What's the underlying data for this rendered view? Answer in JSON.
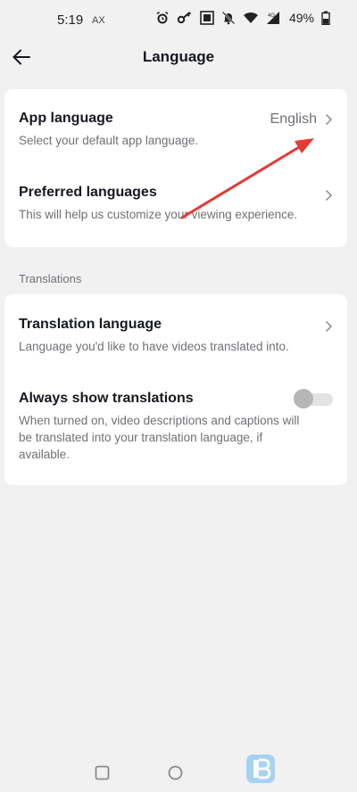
{
  "status_bar": {
    "time": "5:19",
    "carrier": "AX",
    "battery": "49%",
    "icons": [
      "alarm-icon",
      "key-icon",
      "nfc-icon",
      "mute-icon",
      "wifi-icon",
      "signal-4g-icon",
      "battery-icon"
    ]
  },
  "header": {
    "title": "Language",
    "back_icon": "back-arrow-icon"
  },
  "app_section": {
    "app_language": {
      "title": "App language",
      "value": "English",
      "description": "Select your default app language."
    },
    "preferred_languages": {
      "title": "Preferred languages",
      "description": "This will help us customize your viewing experience."
    }
  },
  "translations_section": {
    "label": "Translations",
    "translation_language": {
      "title": "Translation language",
      "description": "Language you'd like to have videos translated into."
    },
    "always_show": {
      "title": "Always show translations",
      "description": "When turned on, video descriptions and captions will be translated into your translation language, if available.",
      "enabled": false
    }
  },
  "annotation": {
    "color": "#e53935"
  },
  "nav_bar": {
    "buttons": [
      "recents-square-icon",
      "home-circle-icon"
    ]
  },
  "colors": {
    "background": "#f1f1f2",
    "card": "#ffffff",
    "primary_text": "#161823",
    "secondary_text": "#6f7079"
  }
}
